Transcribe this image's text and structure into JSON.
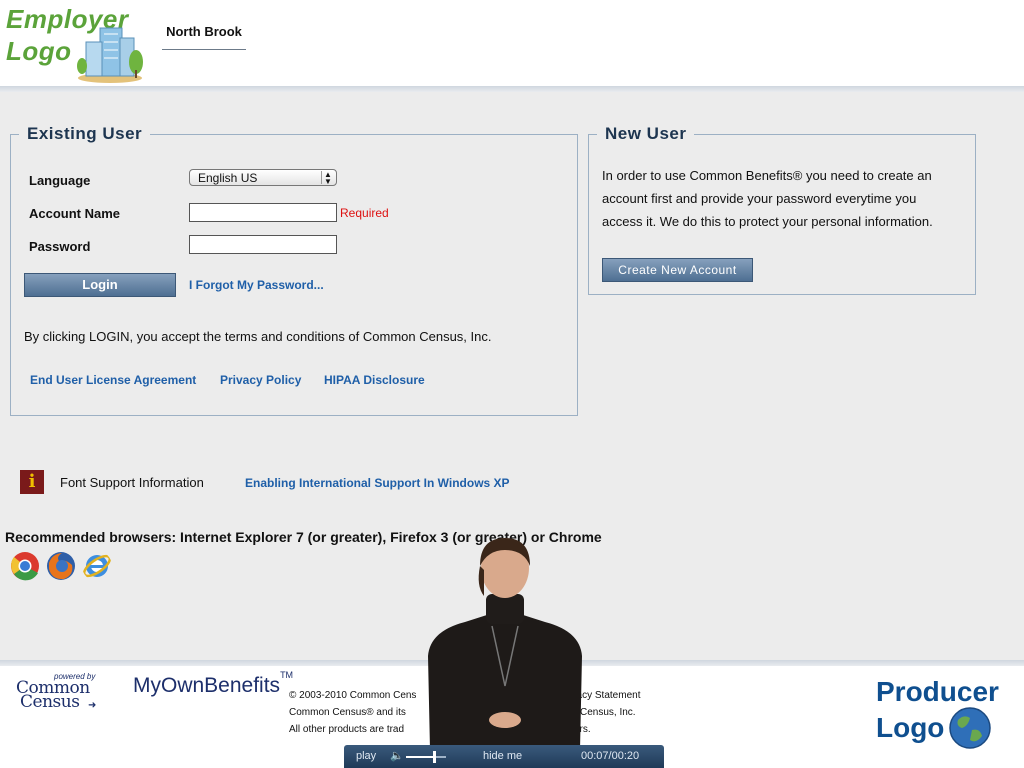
{
  "header": {
    "employer_logo_line1": "Employer",
    "employer_logo_line2": "Logo",
    "site_name": "North Brook"
  },
  "existing_user": {
    "title": "Existing User",
    "language_label": "Language",
    "language_value": "English US",
    "account_name_label": "Account Name",
    "account_name_value": "",
    "required_text": "Required",
    "password_label": "Password",
    "password_value": "",
    "login_button": "Login",
    "forgot_link": "I Forgot My Password...",
    "terms_text": "By clicking LOGIN, you accept the terms and conditions of Common Census, Inc.",
    "links": [
      "End User License Agreement",
      "Privacy Policy",
      "HIPAA Disclosure"
    ]
  },
  "new_user": {
    "title": "New User",
    "line1": "In order to use Common Benefits® you need to create an",
    "line2": "account first and provide your password everytime you",
    "line3": "access it. We do this to protect your personal information.",
    "create_button": "Create New Account"
  },
  "font_support": {
    "icon": "info-icon",
    "label": "Font Support Information",
    "link": "Enabling International Support In Windows XP"
  },
  "browsers": {
    "text": "Recommended browsers: Internet Explorer 7 (or greater), Firefox 3 (or greater) or Chrome",
    "icons": [
      "chrome-icon",
      "firefox-icon",
      "internet-explorer-icon"
    ]
  },
  "footer": {
    "powered_by": "powered by",
    "common": "Common",
    "census": "Census",
    "myownbenefits": "MyOwnBenefits",
    "tm": "TM",
    "copy1": "© 2003-2010 Common Cens",
    "copy1b": "rivacy Statement",
    "copy2": "Common Census® and its",
    "copy2b": "Census, Inc.",
    "copy3": "All other products are trad",
    "copy3b": "ers.",
    "producer_line1": "Producer",
    "producer_line2": "Logo"
  },
  "video": {
    "play_label": "play",
    "hide_label": "hide me",
    "time": "00:07/00:20",
    "volume_fraction": 0.75
  }
}
